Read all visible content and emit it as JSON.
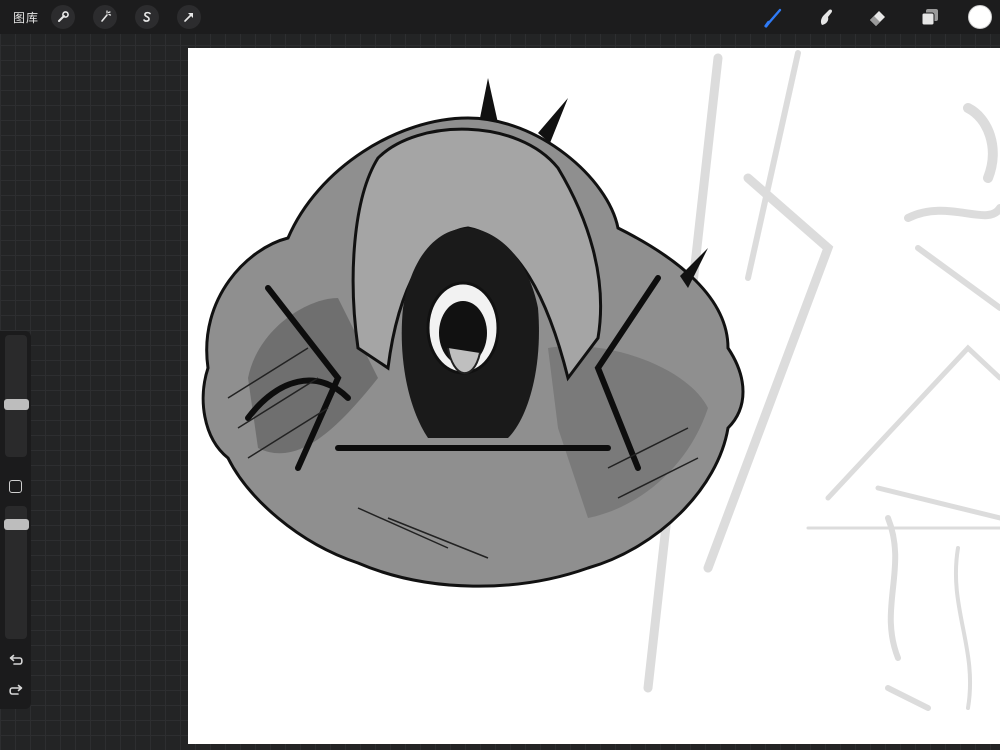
{
  "topbar": {
    "gallery_label": "图库",
    "left_tools": [
      {
        "name": "actions",
        "icon": "wrench-icon"
      },
      {
        "name": "adjustments",
        "icon": "magic-wand-icon"
      },
      {
        "name": "selection",
        "icon": "selection-s-icon"
      },
      {
        "name": "transform",
        "icon": "arrow-cursor-icon"
      }
    ],
    "right_tools": [
      {
        "name": "paint",
        "icon": "brush-icon",
        "active": true
      },
      {
        "name": "smudge",
        "icon": "smudge-finger-icon",
        "active": false
      },
      {
        "name": "erase",
        "icon": "eraser-icon",
        "active": false
      },
      {
        "name": "layers",
        "icon": "layers-icon",
        "active": false
      }
    ],
    "current_color": "#ffffff",
    "active_color": "#2f7bf6"
  },
  "sidebar": {
    "brush_size": 0.5,
    "opacity": 0.8,
    "icons": [
      "square-modify-icon",
      "undo-icon",
      "redo-icon"
    ]
  },
  "canvas": {
    "background": "#ffffff",
    "artwork": "hooded-creature-sketch"
  }
}
